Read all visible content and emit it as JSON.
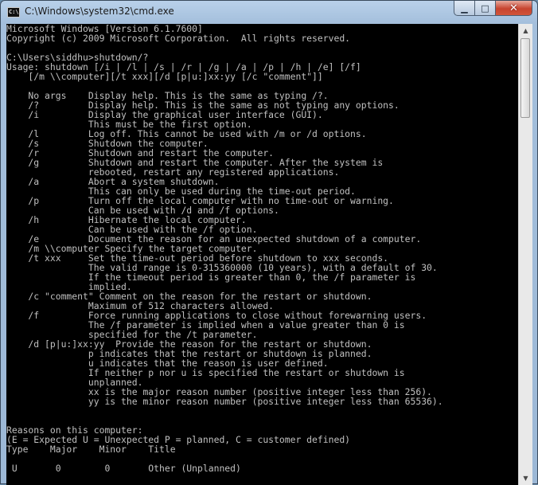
{
  "window": {
    "title": "C:\\Windows\\system32\\cmd.exe",
    "icon_label": "C:\\",
    "icons": {
      "minimize": "minimize-icon",
      "maximize": "maximize-icon",
      "close": "close-icon"
    },
    "colors": {
      "console_bg": "#000000",
      "console_fg": "#c0c0c0",
      "close_red": "#c7442f"
    }
  },
  "console": {
    "lines": [
      "Microsoft Windows [Version 6.1.7600]",
      "Copyright (c) 2009 Microsoft Corporation.  All rights reserved.",
      "",
      "C:\\Users\\siddhu>shutdown/?",
      "Usage: shutdown [/i | /l | /s | /r | /g | /a | /p | /h | /e] [/f]",
      "    [/m \\\\computer][/t xxx][/d [p|u:]xx:yy [/c \"comment\"]]",
      "",
      "    No args    Display help. This is the same as typing /?.",
      "    /?         Display help. This is the same as not typing any options.",
      "    /i         Display the graphical user interface (GUI).",
      "               This must be the first option.",
      "    /l         Log off. This cannot be used with /m or /d options.",
      "    /s         Shutdown the computer.",
      "    /r         Shutdown and restart the computer.",
      "    /g         Shutdown and restart the computer. After the system is",
      "               rebooted, restart any registered applications.",
      "    /a         Abort a system shutdown.",
      "               This can only be used during the time-out period.",
      "    /p         Turn off the local computer with no time-out or warning.",
      "               Can be used with /d and /f options.",
      "    /h         Hibernate the local computer.",
      "               Can be used with the /f option.",
      "    /e         Document the reason for an unexpected shutdown of a computer.",
      "    /m \\\\computer Specify the target computer.",
      "    /t xxx     Set the time-out period before shutdown to xxx seconds.",
      "               The valid range is 0-315360000 (10 years), with a default of 30.",
      "               If the timeout period is greater than 0, the /f parameter is",
      "               implied.",
      "    /c \"comment\" Comment on the reason for the restart or shutdown.",
      "               Maximum of 512 characters allowed.",
      "    /f         Force running applications to close without forewarning users.",
      "               The /f parameter is implied when a value greater than 0 is",
      "               specified for the /t parameter.",
      "    /d [p|u:]xx:yy  Provide the reason for the restart or shutdown.",
      "               p indicates that the restart or shutdown is planned.",
      "               u indicates that the reason is user defined.",
      "               If neither p nor u is specified the restart or shutdown is",
      "               unplanned.",
      "               xx is the major reason number (positive integer less than 256).",
      "               yy is the minor reason number (positive integer less than 65536).",
      "",
      "",
      "Reasons on this computer:",
      "(E = Expected U = Unexpected P = planned, C = customer defined)",
      "Type    Major    Minor    Title",
      "",
      " U       0        0       Other (Unplanned)"
    ]
  },
  "scrollbar": {
    "up_icon": "▲",
    "down_icon": "▼"
  }
}
